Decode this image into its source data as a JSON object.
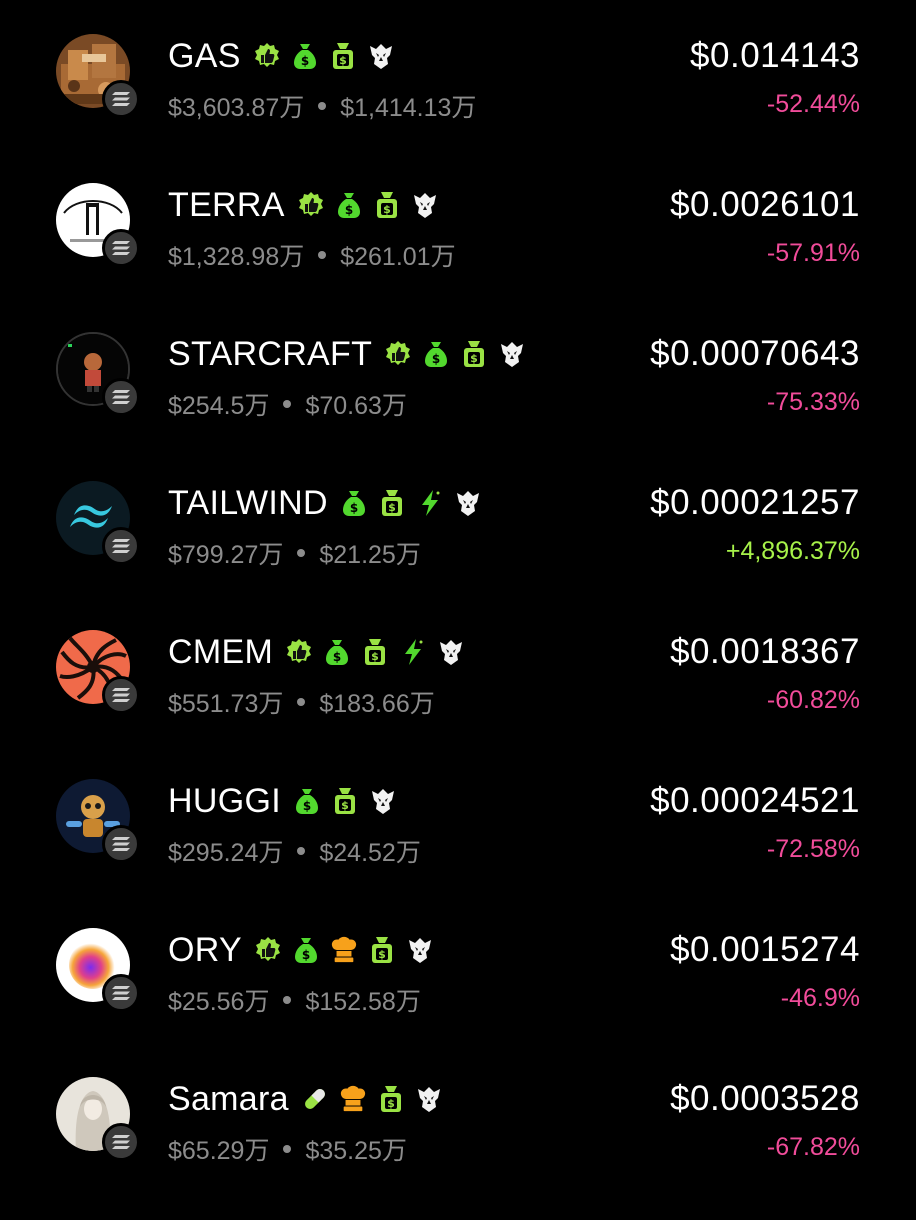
{
  "colors": {
    "background": "#000000",
    "negative": "#f14c9a",
    "positive": "#a7f24a",
    "badge_green": "#52d82e",
    "badge_lime": "#9ae244",
    "badge_orange": "#f7a11b",
    "muted_text": "#8c8c8c"
  },
  "tokens": [
    {
      "name": "GAS",
      "market_cap": "$3,603.87万",
      "volume": "$1,414.13万",
      "price": "$0.014143",
      "change": "-52.44%",
      "direction": "negative",
      "badges": [
        "thumbs-up-badge-icon",
        "money-bag-icon",
        "money-bag-alt-icon",
        "eagle-icon"
      ],
      "chain": "solana-icon"
    },
    {
      "name": "TERRA",
      "market_cap": "$1,328.98万",
      "volume": "$261.01万",
      "price": "$0.0026101",
      "change": "-57.91%",
      "direction": "negative",
      "badges": [
        "thumbs-up-badge-icon",
        "money-bag-icon",
        "money-bag-alt-icon",
        "eagle-icon"
      ],
      "chain": "solana-icon"
    },
    {
      "name": "STARCRAFT",
      "market_cap": "$254.5万",
      "volume": "$70.63万",
      "price": "$0.00070643",
      "change": "-75.33%",
      "direction": "negative",
      "badges": [
        "thumbs-up-badge-icon",
        "money-bag-icon",
        "money-bag-alt-icon",
        "eagle-icon"
      ],
      "chain": "solana-icon"
    },
    {
      "name": "TAILWIND",
      "market_cap": "$799.27万",
      "volume": "$21.25万",
      "price": "$0.00021257",
      "change": "+4,896.37%",
      "direction": "positive",
      "badges": [
        "money-bag-icon",
        "money-bag-alt-icon",
        "lightning-icon",
        "eagle-icon"
      ],
      "chain": "solana-icon"
    },
    {
      "name": "CMEM",
      "market_cap": "$551.73万",
      "volume": "$183.66万",
      "price": "$0.0018367",
      "change": "-60.82%",
      "direction": "negative",
      "badges": [
        "thumbs-up-badge-icon",
        "money-bag-icon",
        "money-bag-alt-icon",
        "lightning-icon",
        "eagle-icon"
      ],
      "chain": "solana-icon"
    },
    {
      "name": "HUGGI",
      "market_cap": "$295.24万",
      "volume": "$24.52万",
      "price": "$0.00024521",
      "change": "-72.58%",
      "direction": "negative",
      "badges": [
        "money-bag-icon",
        "money-bag-alt-icon",
        "eagle-icon"
      ],
      "chain": "solana-icon"
    },
    {
      "name": "ORY",
      "market_cap": "$25.56万",
      "volume": "$152.58万",
      "price": "$0.0015274",
      "change": "-46.9%",
      "direction": "negative",
      "badges": [
        "thumbs-up-badge-icon",
        "money-bag-icon",
        "chef-hat-icon",
        "money-bag-alt-icon",
        "eagle-icon"
      ],
      "chain": "solana-icon"
    },
    {
      "name": "Samara",
      "market_cap": "$65.29万",
      "volume": "$35.25万",
      "price": "$0.0003528",
      "change": "-67.82%",
      "direction": "negative",
      "badges": [
        "pill-icon",
        "chef-hat-icon",
        "money-bag-alt-icon",
        "eagle-icon"
      ],
      "chain": "solana-icon"
    }
  ]
}
